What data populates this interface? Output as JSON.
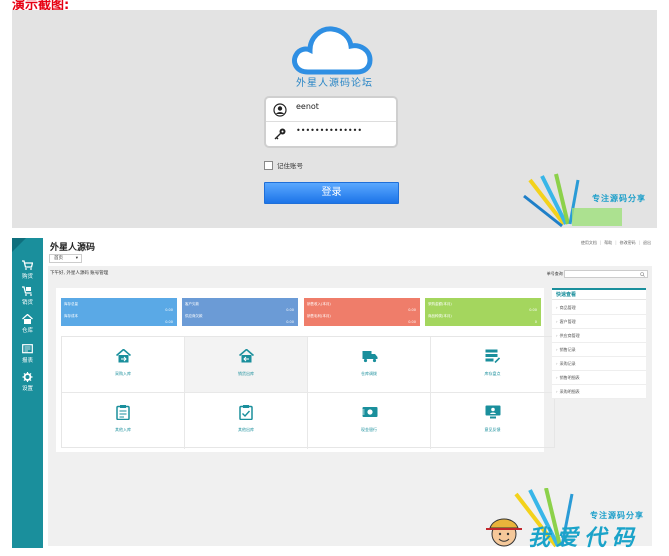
{
  "caption": "演示截图:",
  "login": {
    "forum_title": "外星人源码论坛",
    "username": "eenot",
    "password_mask": "••••••••••••••",
    "remember_label": "记住账号",
    "login_button": "登录"
  },
  "watermark": {
    "top_text": "专注源码分享",
    "bottom_small": "专注源码分享",
    "bottom_big": "我爱代码"
  },
  "dashboard": {
    "app_title": "外星人源码",
    "home_tab": "首页",
    "top_links": [
      "使用文档",
      "帮助",
      "修改密码",
      "退出"
    ],
    "breadcrumb": "下午好, 外星人源码 账号管理",
    "search_label": "单号查询",
    "sidebar": [
      {
        "label": "购货",
        "icon": "cart-icon"
      },
      {
        "label": "销货",
        "icon": "sales-icon"
      },
      {
        "label": "仓库",
        "icon": "warehouse-icon"
      },
      {
        "label": "报表",
        "icon": "report-icon"
      },
      {
        "label": "设置",
        "icon": "gear-icon"
      }
    ],
    "stats": [
      {
        "color": "#5aa9e6",
        "row1_label": "库存总量",
        "row1_value": "0.00",
        "row2_label": "库存成本",
        "row2_value": "0.00"
      },
      {
        "color": "#6b9bd6",
        "row1_label": "客户欠款",
        "row1_value": "0.00",
        "row2_label": "供应商欠款",
        "row2_value": "0.00"
      },
      {
        "color": "#ef7d6a",
        "row1_label": "销售收入(本月)",
        "row1_value": "0.00",
        "row2_label": "销售毛利(本月)",
        "row2_value": "0.00"
      },
      {
        "color": "#a4d65e",
        "row1_label": "采购金额(本月)",
        "row1_value": "0.00",
        "row2_label": "商品种类(本月)",
        "row2_value": "0"
      }
    ],
    "shortcuts": [
      {
        "label": "采购入库",
        "icon": "purchase-in-icon"
      },
      {
        "label": "销货出库",
        "icon": "sales-out-icon"
      },
      {
        "label": "仓库调拨",
        "icon": "transfer-icon"
      },
      {
        "label": "库存盘点",
        "icon": "inventory-icon"
      },
      {
        "label": "其他入库",
        "icon": "other-in-icon"
      },
      {
        "label": "其他出库",
        "icon": "other-out-icon"
      },
      {
        "label": "现金银行",
        "icon": "cash-icon"
      },
      {
        "label": "意见反馈",
        "icon": "feedback-icon"
      }
    ],
    "quick_view": {
      "title": "快速查看",
      "items": [
        "商品管理",
        "客户管理",
        "供应商管理",
        "销售记录",
        "采购记录",
        "销售明细表",
        "采购明细表"
      ]
    }
  }
}
